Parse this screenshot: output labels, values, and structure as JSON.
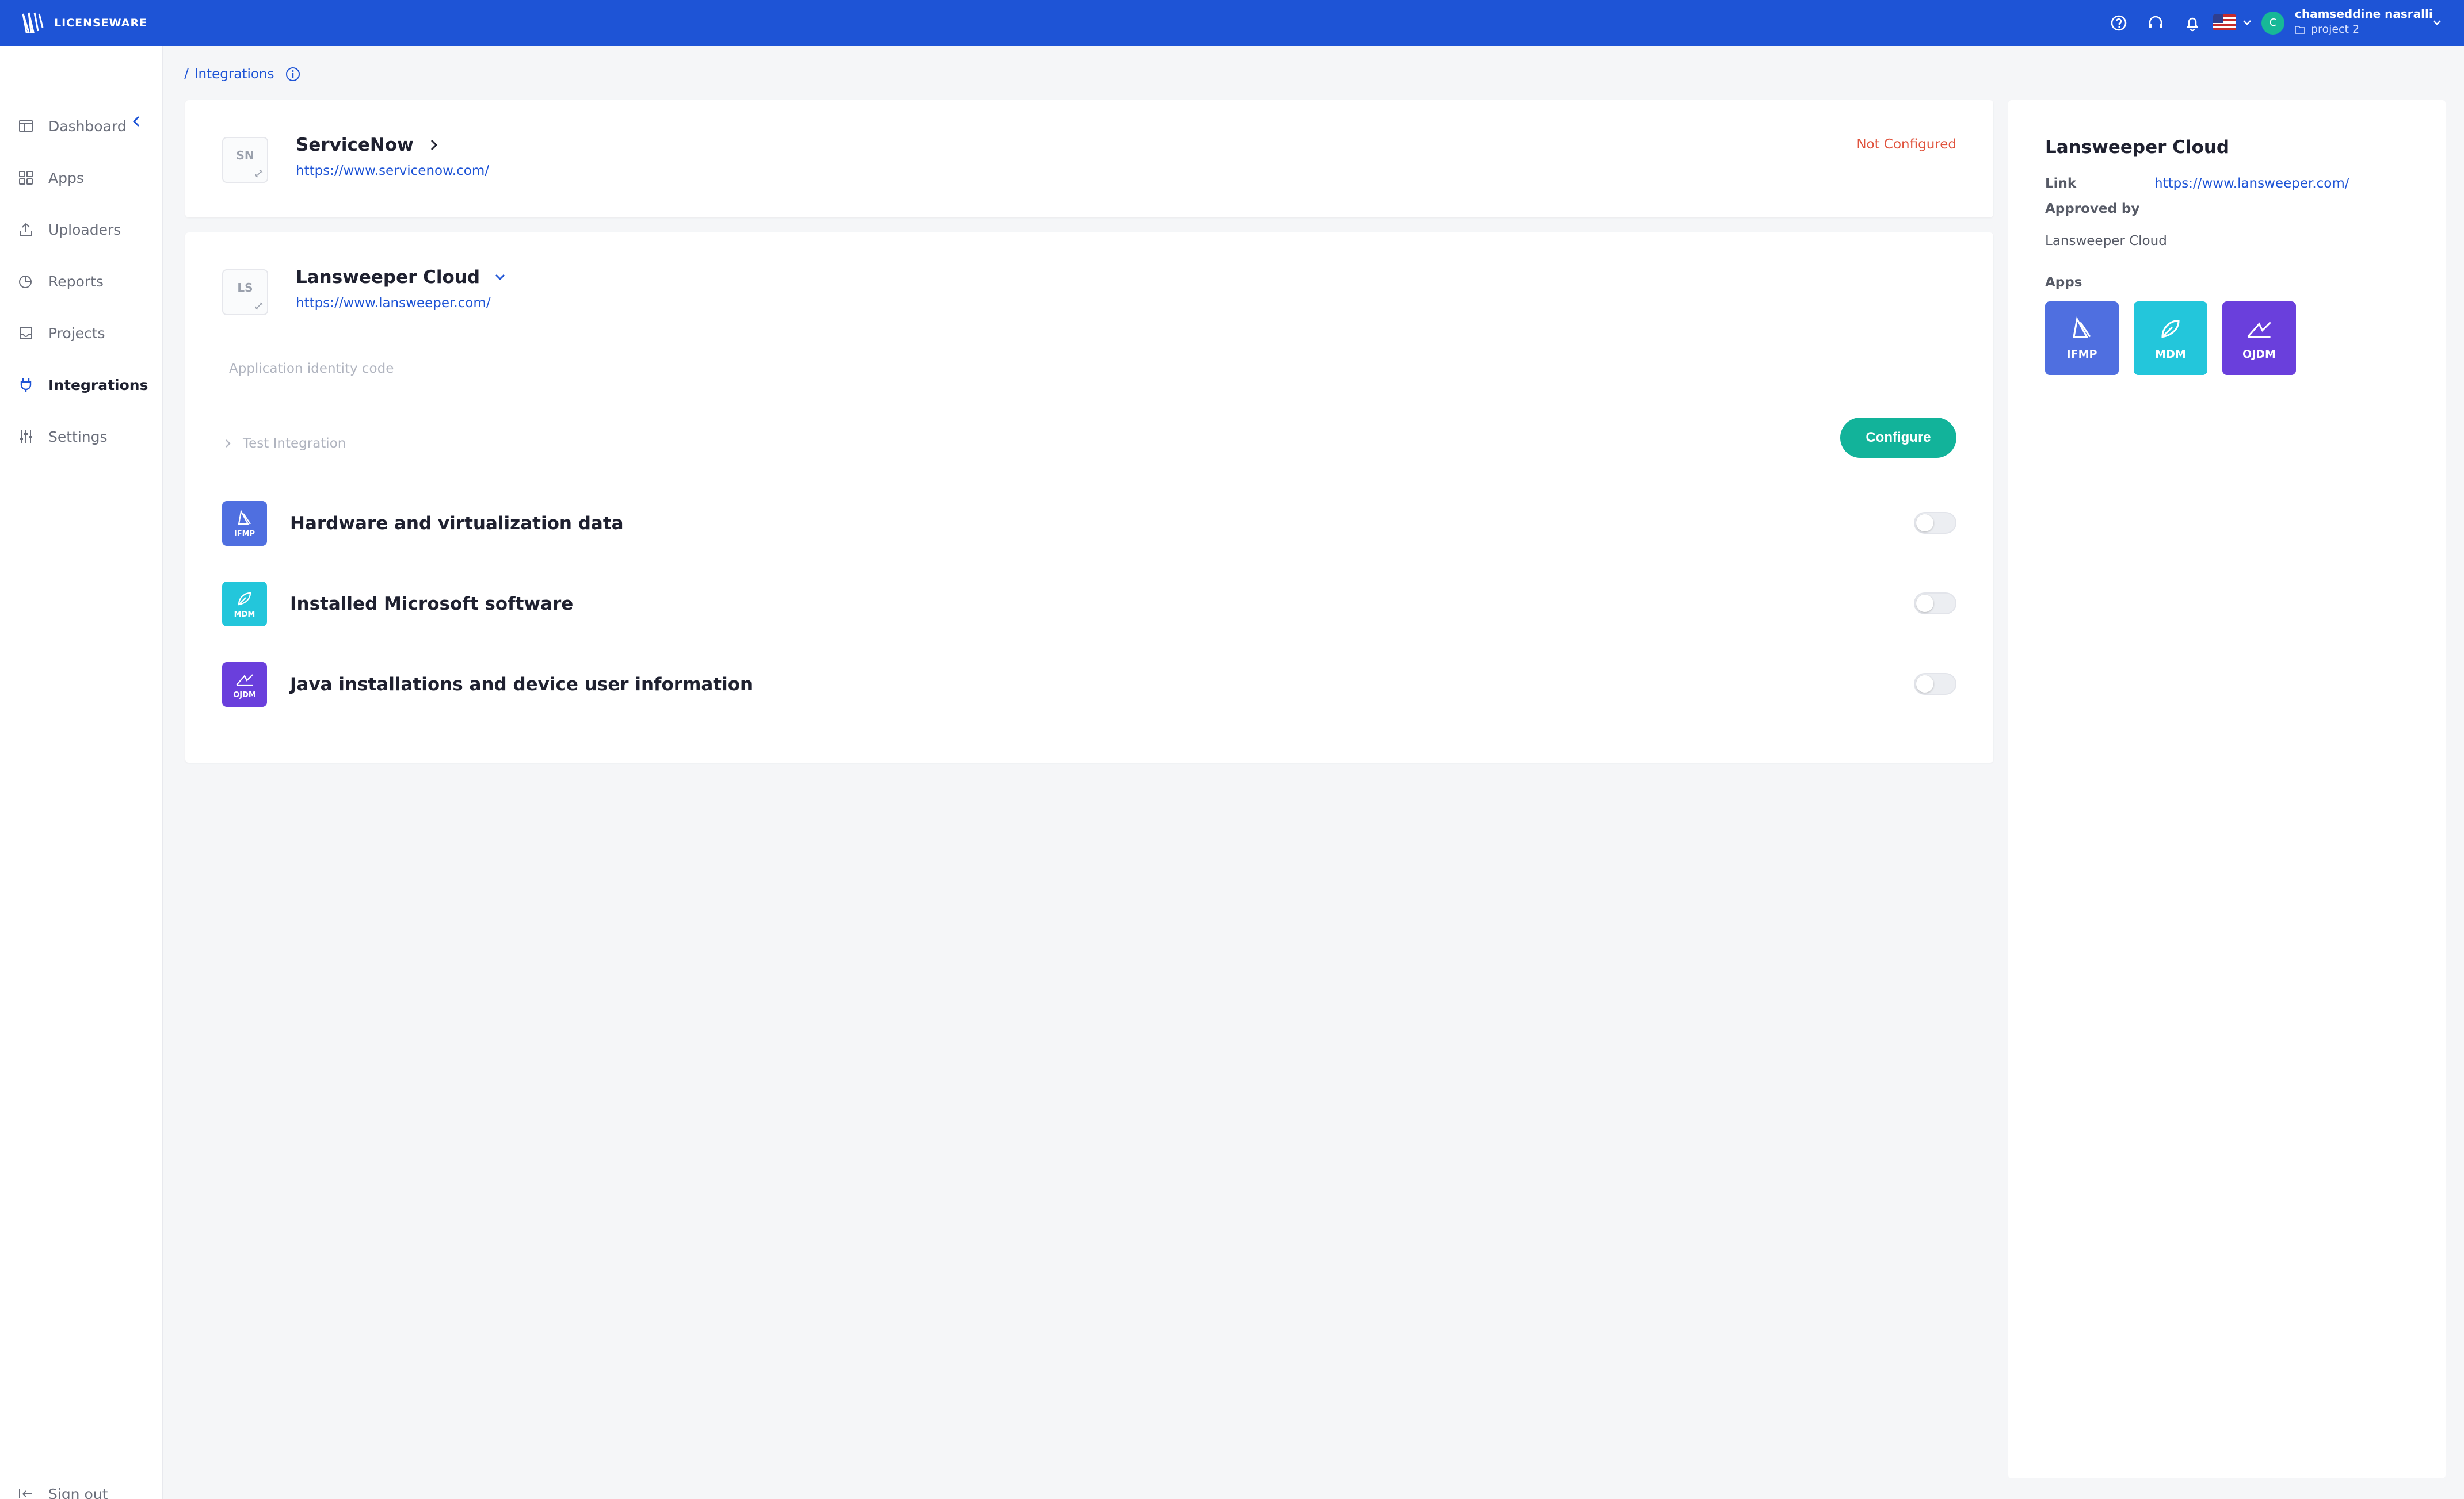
{
  "brand": {
    "name": "LICENSEWARE"
  },
  "user": {
    "name": "chamseddine nasralli",
    "project": "project 2",
    "initial": "C"
  },
  "sidebar": {
    "items": [
      {
        "label": "Dashboard"
      },
      {
        "label": "Apps"
      },
      {
        "label": "Uploaders"
      },
      {
        "label": "Reports"
      },
      {
        "label": "Projects"
      },
      {
        "label": "Integrations"
      },
      {
        "label": "Settings"
      }
    ],
    "signout": "Sign out"
  },
  "breadcrumb": {
    "separator": "/",
    "current": "Integrations"
  },
  "integrations": [
    {
      "abbr": "SN",
      "name": "ServiceNow",
      "url": "https://www.servicenow.com/",
      "status": "Not Configured"
    },
    {
      "abbr": "LS",
      "name": "Lansweeper Cloud",
      "url": "https://www.lansweeper.com/",
      "identity_placeholder": "Application identity code",
      "test_label": "Test Integration",
      "configure_label": "Configure",
      "apps": [
        {
          "code": "IFMP",
          "label": "Hardware and virtualization data",
          "color": "#4f6fe0",
          "enabled": false
        },
        {
          "code": "MDM",
          "label": "Installed Microsoft software",
          "color": "#23c6db",
          "enabled": false
        },
        {
          "code": "OJDM",
          "label": "Java installations and device user information",
          "color": "#6a3fdc",
          "enabled": false
        }
      ]
    }
  ],
  "panel": {
    "title": "Lansweeper Cloud",
    "link_label": "Link",
    "link_url": "https://www.lansweeper.com/",
    "approved_label": "Approved by",
    "approved_value": "Lansweeper Cloud",
    "apps_label": "Apps",
    "apps": [
      {
        "code": "IFMP",
        "color": "#4f6fe0"
      },
      {
        "code": "MDM",
        "color": "#23c6db"
      },
      {
        "code": "OJDM",
        "color": "#6a3fdc"
      }
    ]
  },
  "colors": {
    "topbar": "#1e54d6",
    "accent": "#12b39a",
    "status_error": "#e0533d"
  }
}
